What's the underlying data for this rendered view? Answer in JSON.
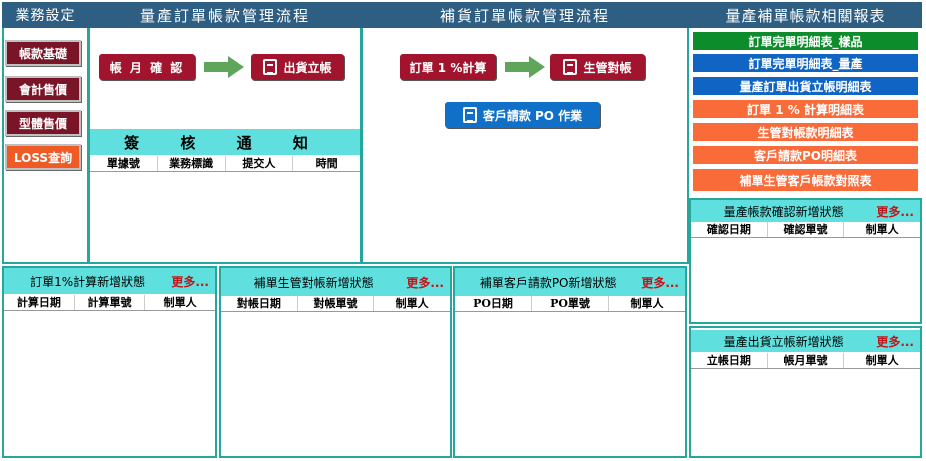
{
  "headers": {
    "business_settings": "業務設定",
    "mass_production_flow": "量產訂單帳款管理流程",
    "replenish_flow": "補貨訂單帳款管理流程",
    "reports": "量產補單帳款相關報表"
  },
  "sidebar": {
    "items": [
      {
        "label": "帳款基礎"
      },
      {
        "label": "會計售價"
      },
      {
        "label": "型體售價"
      },
      {
        "label": "LOSS查詢"
      }
    ]
  },
  "mass_flow": {
    "step1": "帳 月 確 認",
    "step2": "出貨立帳"
  },
  "replenish_flow": {
    "step1": "訂單 1 %計算",
    "step2": "生管對帳",
    "step3": "客戶請款 PO 作業"
  },
  "sign_notice": {
    "title": "簽 核 通 知",
    "columns": [
      "單據號",
      "業務標識",
      "提交人",
      "時間"
    ]
  },
  "reports": {
    "items": [
      {
        "label": "訂單完單明細表_樣品",
        "color": "#0c8c2a"
      },
      {
        "label": "訂單完單明細表_量產",
        "color": "#0f64c4"
      },
      {
        "label": "量產訂單出貨立帳明細表",
        "color": "#0f64c4"
      },
      {
        "label": "訂單 1 % 計算明細表",
        "color": "#fa6b3a"
      },
      {
        "label": "生管對帳款明細表",
        "color": "#fa6b3a"
      },
      {
        "label": "客戶請款PO明細表",
        "color": "#fa6b3a"
      },
      {
        "label": "補單生管客戶帳款對照表",
        "color": "#fa6b3a"
      }
    ]
  },
  "status_panels": {
    "more": "更多...",
    "confirm": {
      "title": "量產帳款確認新增狀態",
      "columns": [
        "確認日期",
        "確認單號",
        "制單人"
      ]
    },
    "shipment": {
      "title": "量產出貨立帳新增狀態",
      "columns": [
        "立帳日期",
        "帳月單號",
        "制單人"
      ]
    },
    "calc": {
      "title": "訂單1%計算新增狀態",
      "columns": [
        "計算日期",
        "計算單號",
        "制單人"
      ]
    },
    "reconcile": {
      "title": "補單生管對帳新增狀態",
      "columns": [
        "對帳日期",
        "對帳單號",
        "制單人"
      ]
    },
    "po": {
      "title": "補單客戶請款PO新增狀態",
      "columns": [
        "PO日期",
        "PO單號",
        "制單人"
      ]
    }
  }
}
